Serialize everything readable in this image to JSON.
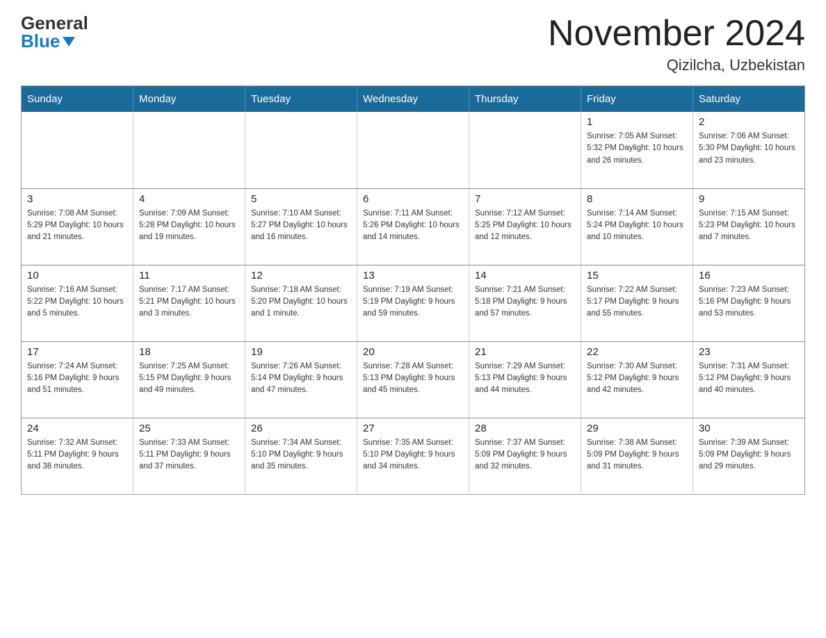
{
  "logo": {
    "line1": "General",
    "line2": "Blue"
  },
  "title": {
    "month_year": "November 2024",
    "location": "Qizilcha, Uzbekistan"
  },
  "weekdays": [
    "Sunday",
    "Monday",
    "Tuesday",
    "Wednesday",
    "Thursday",
    "Friday",
    "Saturday"
  ],
  "weeks": [
    [
      {
        "day": "",
        "info": ""
      },
      {
        "day": "",
        "info": ""
      },
      {
        "day": "",
        "info": ""
      },
      {
        "day": "",
        "info": ""
      },
      {
        "day": "",
        "info": ""
      },
      {
        "day": "1",
        "info": "Sunrise: 7:05 AM\nSunset: 5:32 PM\nDaylight: 10 hours and 26 minutes."
      },
      {
        "day": "2",
        "info": "Sunrise: 7:06 AM\nSunset: 5:30 PM\nDaylight: 10 hours and 23 minutes."
      }
    ],
    [
      {
        "day": "3",
        "info": "Sunrise: 7:08 AM\nSunset: 5:29 PM\nDaylight: 10 hours and 21 minutes."
      },
      {
        "day": "4",
        "info": "Sunrise: 7:09 AM\nSunset: 5:28 PM\nDaylight: 10 hours and 19 minutes."
      },
      {
        "day": "5",
        "info": "Sunrise: 7:10 AM\nSunset: 5:27 PM\nDaylight: 10 hours and 16 minutes."
      },
      {
        "day": "6",
        "info": "Sunrise: 7:11 AM\nSunset: 5:26 PM\nDaylight: 10 hours and 14 minutes."
      },
      {
        "day": "7",
        "info": "Sunrise: 7:12 AM\nSunset: 5:25 PM\nDaylight: 10 hours and 12 minutes."
      },
      {
        "day": "8",
        "info": "Sunrise: 7:14 AM\nSunset: 5:24 PM\nDaylight: 10 hours and 10 minutes."
      },
      {
        "day": "9",
        "info": "Sunrise: 7:15 AM\nSunset: 5:23 PM\nDaylight: 10 hours and 7 minutes."
      }
    ],
    [
      {
        "day": "10",
        "info": "Sunrise: 7:16 AM\nSunset: 5:22 PM\nDaylight: 10 hours and 5 minutes."
      },
      {
        "day": "11",
        "info": "Sunrise: 7:17 AM\nSunset: 5:21 PM\nDaylight: 10 hours and 3 minutes."
      },
      {
        "day": "12",
        "info": "Sunrise: 7:18 AM\nSunset: 5:20 PM\nDaylight: 10 hours and 1 minute."
      },
      {
        "day": "13",
        "info": "Sunrise: 7:19 AM\nSunset: 5:19 PM\nDaylight: 9 hours and 59 minutes."
      },
      {
        "day": "14",
        "info": "Sunrise: 7:21 AM\nSunset: 5:18 PM\nDaylight: 9 hours and 57 minutes."
      },
      {
        "day": "15",
        "info": "Sunrise: 7:22 AM\nSunset: 5:17 PM\nDaylight: 9 hours and 55 minutes."
      },
      {
        "day": "16",
        "info": "Sunrise: 7:23 AM\nSunset: 5:16 PM\nDaylight: 9 hours and 53 minutes."
      }
    ],
    [
      {
        "day": "17",
        "info": "Sunrise: 7:24 AM\nSunset: 5:16 PM\nDaylight: 9 hours and 51 minutes."
      },
      {
        "day": "18",
        "info": "Sunrise: 7:25 AM\nSunset: 5:15 PM\nDaylight: 9 hours and 49 minutes."
      },
      {
        "day": "19",
        "info": "Sunrise: 7:26 AM\nSunset: 5:14 PM\nDaylight: 9 hours and 47 minutes."
      },
      {
        "day": "20",
        "info": "Sunrise: 7:28 AM\nSunset: 5:13 PM\nDaylight: 9 hours and 45 minutes."
      },
      {
        "day": "21",
        "info": "Sunrise: 7:29 AM\nSunset: 5:13 PM\nDaylight: 9 hours and 44 minutes."
      },
      {
        "day": "22",
        "info": "Sunrise: 7:30 AM\nSunset: 5:12 PM\nDaylight: 9 hours and 42 minutes."
      },
      {
        "day": "23",
        "info": "Sunrise: 7:31 AM\nSunset: 5:12 PM\nDaylight: 9 hours and 40 minutes."
      }
    ],
    [
      {
        "day": "24",
        "info": "Sunrise: 7:32 AM\nSunset: 5:11 PM\nDaylight: 9 hours and 38 minutes."
      },
      {
        "day": "25",
        "info": "Sunrise: 7:33 AM\nSunset: 5:11 PM\nDaylight: 9 hours and 37 minutes."
      },
      {
        "day": "26",
        "info": "Sunrise: 7:34 AM\nSunset: 5:10 PM\nDaylight: 9 hours and 35 minutes."
      },
      {
        "day": "27",
        "info": "Sunrise: 7:35 AM\nSunset: 5:10 PM\nDaylight: 9 hours and 34 minutes."
      },
      {
        "day": "28",
        "info": "Sunrise: 7:37 AM\nSunset: 5:09 PM\nDaylight: 9 hours and 32 minutes."
      },
      {
        "day": "29",
        "info": "Sunrise: 7:38 AM\nSunset: 5:09 PM\nDaylight: 9 hours and 31 minutes."
      },
      {
        "day": "30",
        "info": "Sunrise: 7:39 AM\nSunset: 5:09 PM\nDaylight: 9 hours and 29 minutes."
      }
    ]
  ]
}
